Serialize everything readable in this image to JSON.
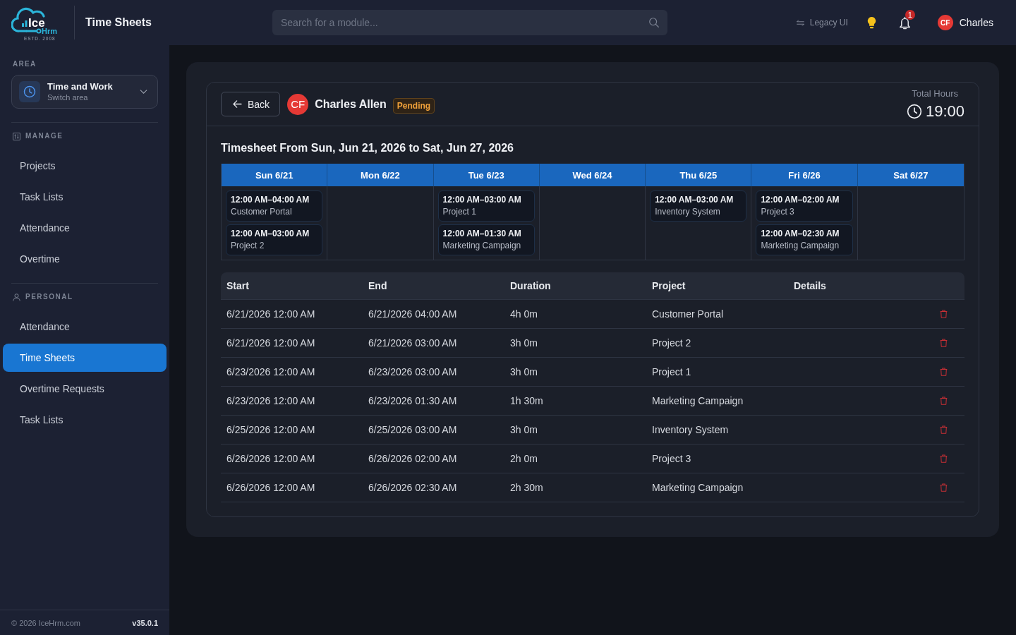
{
  "top_bar": {
    "logo": {
      "name": "Ice",
      "suffix": "Hrm",
      "tagline": "ESTD. 2008"
    },
    "page_title": "Time Sheets",
    "search": {
      "placeholder": "Search for a module..."
    },
    "legacy_link": "Legacy UI",
    "notifications": {
      "count": "1"
    },
    "user": {
      "initials": "CF",
      "name": "Charles"
    }
  },
  "sidebar": {
    "area_label": "AREA",
    "area_switcher": {
      "title": "Time and Work",
      "subtitle": "Switch area"
    },
    "sections": [
      {
        "title": "MANAGE",
        "items": [
          {
            "label": "Projects",
            "selected": false
          },
          {
            "label": "Task Lists",
            "selected": false
          },
          {
            "label": "Attendance",
            "selected": false
          },
          {
            "label": "Overtime",
            "selected": false
          }
        ]
      },
      {
        "title": "PERSONAL",
        "items": [
          {
            "label": "Attendance",
            "selected": false
          },
          {
            "label": "Time Sheets",
            "selected": true
          },
          {
            "label": "Overtime Requests",
            "selected": false
          },
          {
            "label": "Task Lists",
            "selected": false
          }
        ]
      }
    ],
    "footer": {
      "copyright": "© 2026 IceHrm.com",
      "version": "v35.0.1"
    }
  },
  "timesheet": {
    "back_button": "Back",
    "employee": {
      "initials": "CF",
      "name": "Charles Allen"
    },
    "status": "Pending",
    "total_hours": {
      "label": "Total Hours",
      "value": "19:00"
    },
    "title": "Timesheet From Sun, Jun 21, 2026 to Sat, Jun 27, 2026",
    "week": [
      {
        "day": "Sun 6/21",
        "entries": [
          {
            "time": "12:00 AM–04:00 AM",
            "project": "Customer Portal"
          },
          {
            "time": "12:00 AM–03:00 AM",
            "project": "Project 2"
          }
        ]
      },
      {
        "day": "Mon 6/22"
      },
      {
        "day": "Tue 6/23",
        "entries": [
          {
            "time": "12:00 AM–03:00 AM",
            "project": "Project 1"
          },
          {
            "time": "12:00 AM–01:30 AM",
            "project": "Marketing Campaign"
          }
        ]
      },
      {
        "day": "Wed 6/24"
      },
      {
        "day": "Thu 6/25",
        "entries": [
          {
            "time": "12:00 AM–03:00 AM",
            "project": "Inventory System"
          }
        ]
      },
      {
        "day": "Fri 6/26",
        "entries": [
          {
            "time": "12:00 AM–02:00 AM",
            "project": "Project 3"
          },
          {
            "time": "12:00 AM–02:30 AM",
            "project": "Marketing Campaign"
          }
        ]
      },
      {
        "day": "Sat 6/27"
      }
    ],
    "table": {
      "columns": [
        "Start",
        "End",
        "Duration",
        "Project",
        "Details"
      ],
      "rows": [
        {
          "start": "6/21/2026 12:00 AM",
          "end": "6/21/2026 04:00 AM",
          "duration": "4h 0m",
          "project": "Customer Portal"
        },
        {
          "start": "6/21/2026 12:00 AM",
          "end": "6/21/2026 03:00 AM",
          "duration": "3h 0m",
          "project": "Project 2"
        },
        {
          "start": "6/23/2026 12:00 AM",
          "end": "6/23/2026 03:00 AM",
          "duration": "3h 0m",
          "project": "Project 1"
        },
        {
          "start": "6/23/2026 12:00 AM",
          "end": "6/23/2026 01:30 AM",
          "duration": "1h 30m",
          "project": "Marketing Campaign"
        },
        {
          "start": "6/25/2026 12:00 AM",
          "end": "6/25/2026 03:00 AM",
          "duration": "3h 0m",
          "project": "Inventory System"
        },
        {
          "start": "6/26/2026 12:00 AM",
          "end": "6/26/2026 02:00 AM",
          "duration": "2h 0m",
          "project": "Project 3"
        },
        {
          "start": "6/26/2026 12:00 AM",
          "end": "6/26/2026 02:30 AM",
          "duration": "2h 30m",
          "project": "Marketing Campaign"
        }
      ]
    }
  }
}
